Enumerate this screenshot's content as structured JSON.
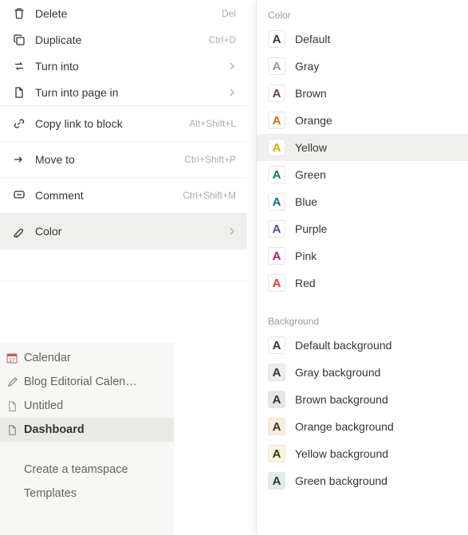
{
  "menu": {
    "delete": {
      "label": "Delete",
      "shortcut": "Del"
    },
    "duplicate": {
      "label": "Duplicate",
      "shortcut": "Ctrl+D"
    },
    "turn_into": {
      "label": "Turn into"
    },
    "turn_into_page": {
      "label": "Turn into page in"
    },
    "copy_link": {
      "label": "Copy link to block",
      "shortcut": "Alt+Shift+L"
    },
    "move_to": {
      "label": "Move to",
      "shortcut": "Ctrl+Shift+P"
    },
    "comment": {
      "label": "Comment",
      "shortcut": "Ctrl+Shift+M"
    },
    "color": {
      "label": "Color"
    }
  },
  "sidebar": {
    "calendar": "Calendar",
    "blog": "Blog Editorial Calen…",
    "untitled": "Untitled",
    "dashboard": "Dashboard",
    "create_teamspace": "Create a teamspace",
    "templates": "Templates"
  },
  "color_panel": {
    "color_title": "Color",
    "background_title": "Background",
    "colors": {
      "default": {
        "label": "Default",
        "hex": "#37352f"
      },
      "gray": {
        "label": "Gray",
        "hex": "#9b9a97"
      },
      "brown": {
        "label": "Brown",
        "hex": "#64473a"
      },
      "orange": {
        "label": "Orange",
        "hex": "#d9730d"
      },
      "yellow": {
        "label": "Yellow",
        "hex": "#dfab01"
      },
      "green": {
        "label": "Green",
        "hex": "#0f7b6c"
      },
      "blue": {
        "label": "Blue",
        "hex": "#0b6e99"
      },
      "purple": {
        "label": "Purple",
        "hex": "#6940a5"
      },
      "pink": {
        "label": "Pink",
        "hex": "#ad1a72"
      },
      "red": {
        "label": "Red",
        "hex": "#e03e3e"
      }
    },
    "backgrounds": {
      "default": {
        "label": "Default background",
        "bg": "#ffffff",
        "fg": "#37352f"
      },
      "gray": {
        "label": "Gray background",
        "bg": "#ebeced",
        "fg": "#37352f"
      },
      "brown": {
        "label": "Brown background",
        "bg": "#e9e5e3",
        "fg": "#37352f"
      },
      "orange": {
        "label": "Orange background",
        "bg": "#faebdd",
        "fg": "#37352f"
      },
      "yellow": {
        "label": "Yellow background",
        "bg": "#fbf3db",
        "fg": "#37352f"
      },
      "green": {
        "label": "Green background",
        "bg": "#ddedea",
        "fg": "#37352f"
      }
    },
    "swatch_letter": "A"
  }
}
